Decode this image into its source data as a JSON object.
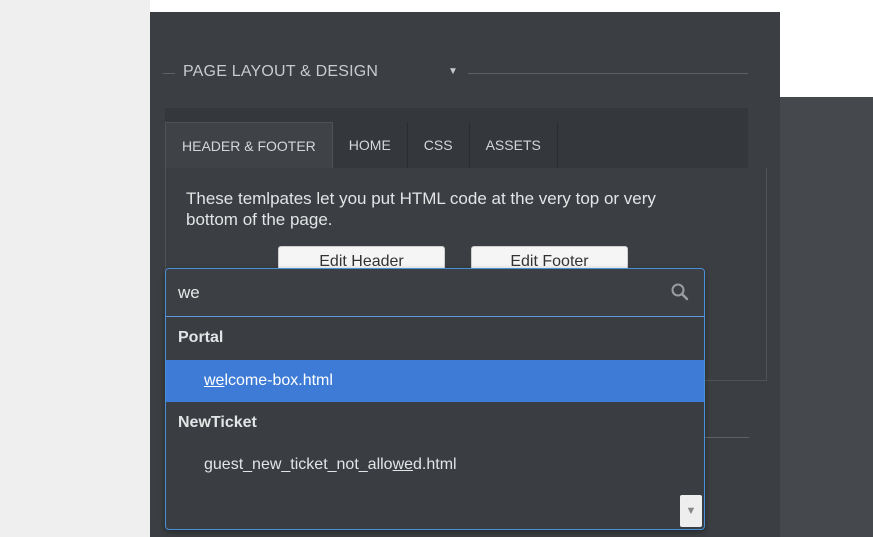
{
  "section": {
    "title": "PAGE LAYOUT & DESIGN",
    "caret_icon": "caret-down-icon"
  },
  "tabs": [
    {
      "label": "HEADER & FOOTER",
      "active": true
    },
    {
      "label": "HOME",
      "active": false
    },
    {
      "label": "CSS",
      "active": false
    },
    {
      "label": "ASSETS",
      "active": false
    }
  ],
  "content": {
    "description": "These temlpates let you put HTML code at the very top or very bottom of the page.",
    "edit_header_label": "Edit Header",
    "edit_footer_label": "Edit Footer"
  },
  "dropdown": {
    "query": "we",
    "search_icon": "search-icon",
    "groups": [
      {
        "label": "Portal",
        "options": [
          {
            "pre": "",
            "match": "we",
            "post": "lcome-box.html",
            "selected": true
          }
        ]
      },
      {
        "label": "NewTicket",
        "options": [
          {
            "pre": "guest_new_ticket_not_allo",
            "match": "we",
            "post": "d.html",
            "selected": false
          }
        ]
      }
    ],
    "scroll_icon": "scroll-down-arrow-icon"
  },
  "colors": {
    "panel": "#3b3e42",
    "accent": "#3d7bd6",
    "focus_border": "#4a90d9"
  }
}
